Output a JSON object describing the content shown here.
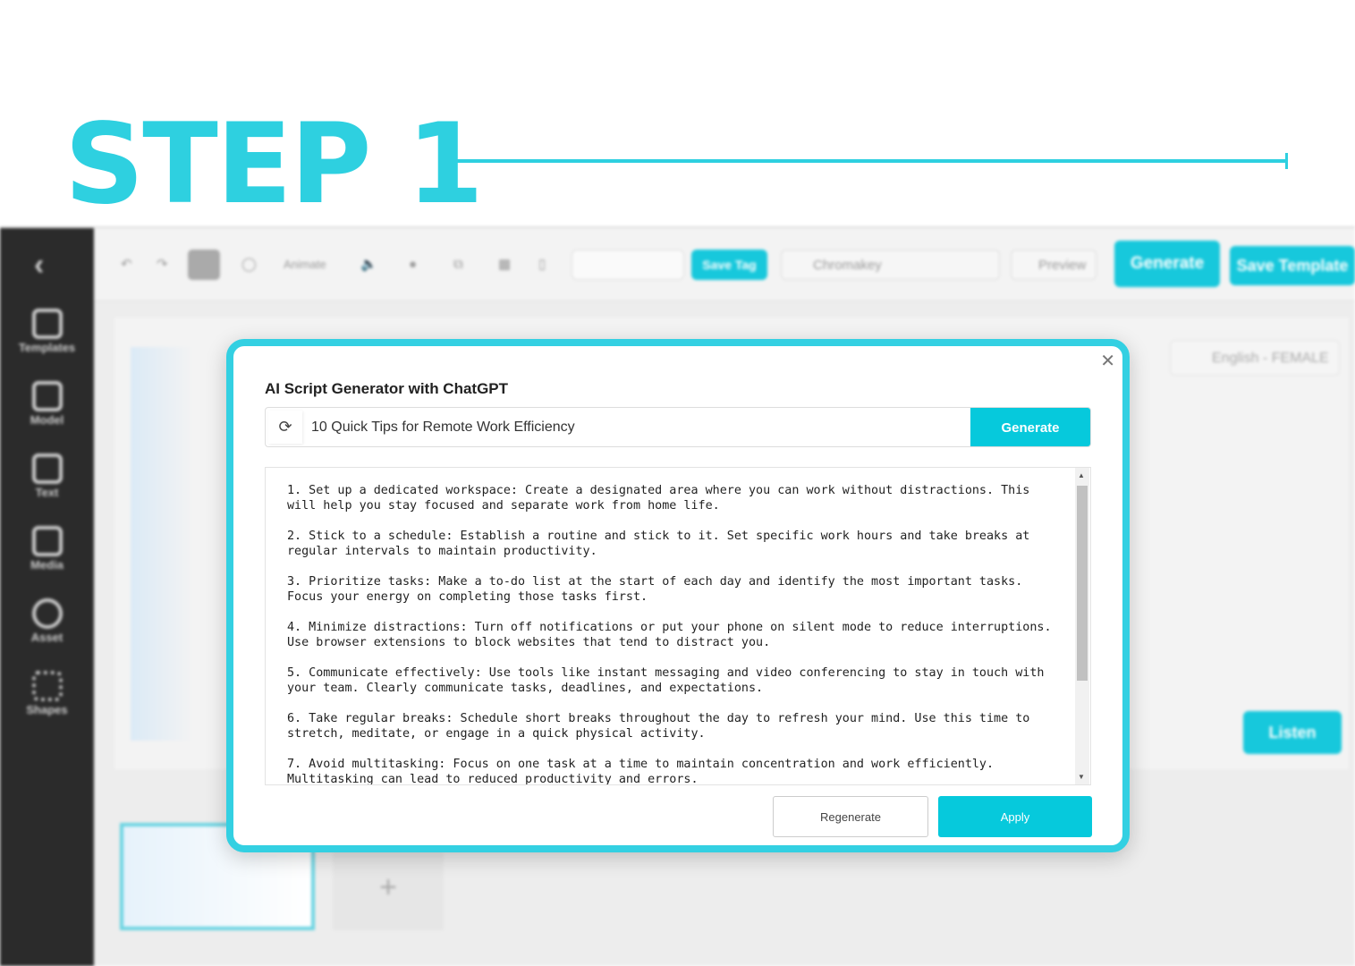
{
  "step": {
    "title": "STEP 1"
  },
  "sidebar": {
    "items": [
      {
        "label": "Templates",
        "icon": "template-icon"
      },
      {
        "label": "Model",
        "icon": "person-icon"
      },
      {
        "label": "Text",
        "icon": "text-icon"
      },
      {
        "label": "Media",
        "icon": "image-icon"
      },
      {
        "label": "Asset",
        "icon": "cloud-upload-icon"
      },
      {
        "label": "Shapes",
        "icon": "shapes-icon"
      }
    ]
  },
  "toolbar": {
    "animate": "Animate",
    "save_tag": "Save Tag",
    "chromakey": "Chromakey",
    "preview": "Preview",
    "generate": "Generate",
    "save_template": "Save Template"
  },
  "voice": {
    "language": "English - FEMALE",
    "listen": "Listen"
  },
  "modal": {
    "title": "AI Script Generator with ChatGPT",
    "prompt_value": "10 Quick Tips for Remote Work Efficiency",
    "generate_label": "Generate",
    "script": [
      "1. Set up a dedicated workspace: Create a designated area where you can work without distractions. This will help you stay focused and separate work from home life.",
      "2. Stick to a schedule: Establish a routine and stick to it. Set specific work hours and take breaks at regular intervals to maintain productivity.",
      "3. Prioritize tasks: Make a to-do list at the start of each day and identify the most important tasks. Focus your energy on completing those tasks first.",
      "4. Minimize distractions: Turn off notifications or put your phone on silent mode to reduce interruptions. Use browser extensions to block websites that tend to distract you.",
      "5. Communicate effectively: Use tools like instant messaging and video conferencing to stay in touch with your team. Clearly communicate tasks, deadlines, and expectations.",
      "6. Take regular breaks: Schedule short breaks throughout the day to refresh your mind. Use this time to stretch, meditate, or engage in a quick physical activity.",
      "7. Avoid multitasking: Focus on one task at a time to maintain concentration and work efficiently. Multitasking can lead to reduced productivity and errors."
    ],
    "regenerate_label": "Regenerate",
    "apply_label": "Apply"
  },
  "colors": {
    "accent": "#2ed0e0",
    "button": "#06c9dc",
    "sidebar": "#2b2b2b"
  }
}
